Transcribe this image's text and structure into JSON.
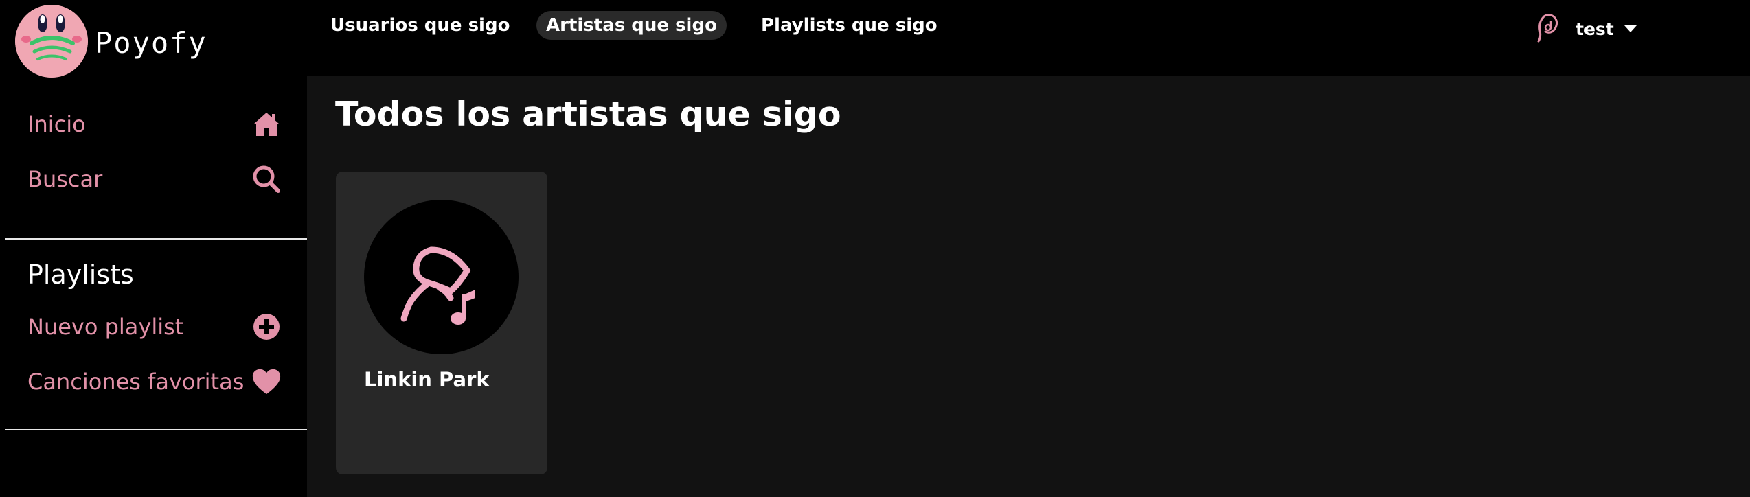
{
  "brand": {
    "name": "Poyofy"
  },
  "sidebar": {
    "nav": [
      {
        "label": "Inicio",
        "icon": "home-icon"
      },
      {
        "label": "Buscar",
        "icon": "search-icon"
      }
    ],
    "section_title": "Playlists",
    "playlist_actions": [
      {
        "label": "Nuevo playlist",
        "icon": "plus-circle-icon"
      },
      {
        "label": "Canciones favoritas",
        "icon": "heart-icon"
      }
    ]
  },
  "topnav": {
    "tabs": [
      {
        "label": "Usuarios que sigo",
        "active": false
      },
      {
        "label": "Artistas que sigo",
        "active": true
      },
      {
        "label": "Playlists que sigo",
        "active": false
      }
    ],
    "user": {
      "name": "test",
      "icon": "user-music-icon"
    }
  },
  "main": {
    "title": "Todos los artistas que sigo",
    "artists": [
      {
        "name": "Linkin Park",
        "icon": "artist-music-icon"
      }
    ]
  },
  "colors": {
    "accent": "#e291a8",
    "background": "#000000",
    "main_bg": "#121212",
    "card_bg": "#282828",
    "active_tab_bg": "#2a2a2a"
  }
}
